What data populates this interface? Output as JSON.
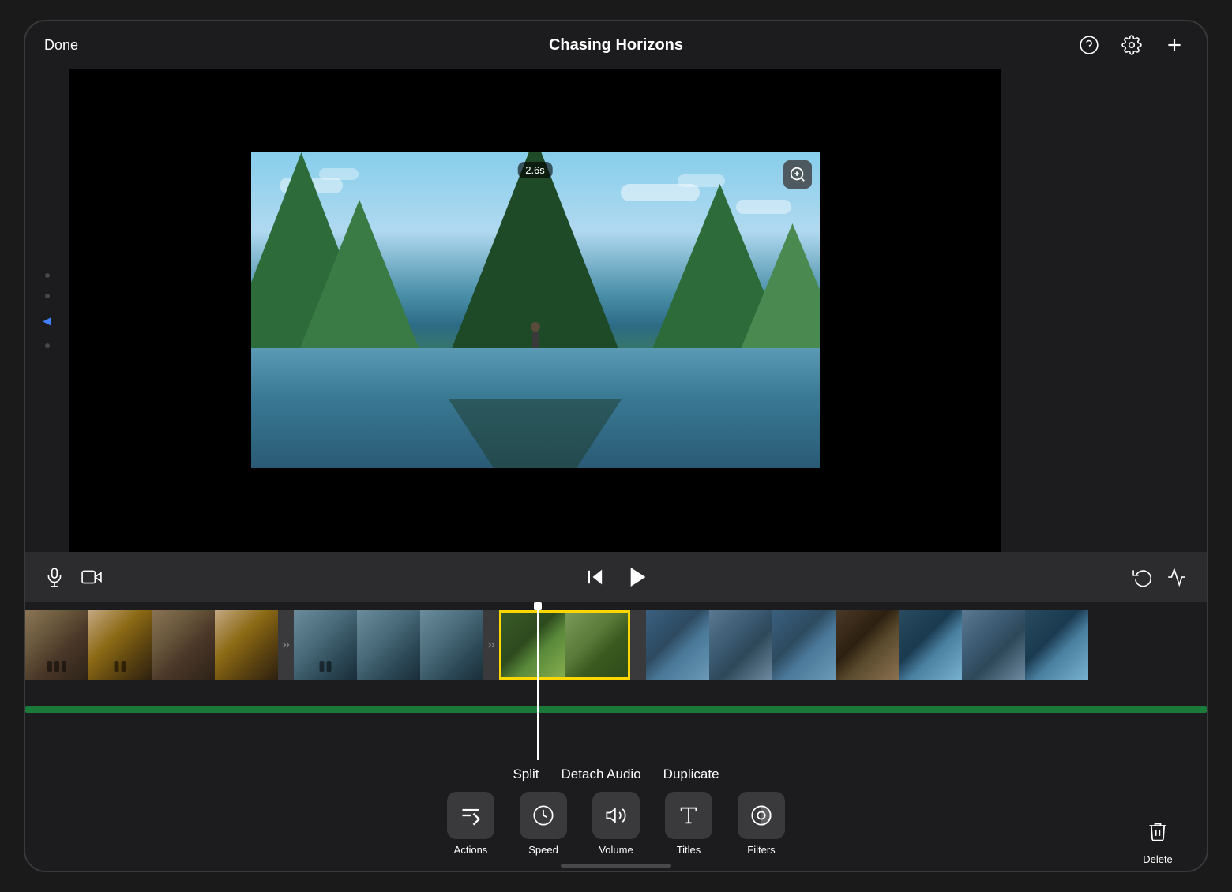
{
  "app": {
    "title": "Chasing Horizons"
  },
  "topbar": {
    "done_label": "Done",
    "title": "Chasing Horizons",
    "help_icon": "?",
    "settings_icon": "⚙",
    "add_icon": "+"
  },
  "preview": {
    "timestamp": "2.6s",
    "zoom_icon": "zoom"
  },
  "controls": {
    "mic_icon": "microphone",
    "camera_icon": "camera",
    "skip_back_icon": "skip-back",
    "play_icon": "play",
    "undo_icon": "undo",
    "audio_wave_icon": "audio-wave"
  },
  "context_menu": {
    "split_label": "Split",
    "detach_audio_label": "Detach Audio",
    "duplicate_label": "Duplicate"
  },
  "toolbar": {
    "items": [
      {
        "id": "actions",
        "label": "Actions",
        "icon": "scissors"
      },
      {
        "id": "speed",
        "label": "Speed",
        "icon": "speed"
      },
      {
        "id": "volume",
        "label": "Volume",
        "icon": "volume"
      },
      {
        "id": "titles",
        "label": "Titles",
        "icon": "titles"
      },
      {
        "id": "filters",
        "label": "Filters",
        "icon": "filters"
      }
    ],
    "delete_label": "Delete",
    "delete_icon": "trash"
  }
}
